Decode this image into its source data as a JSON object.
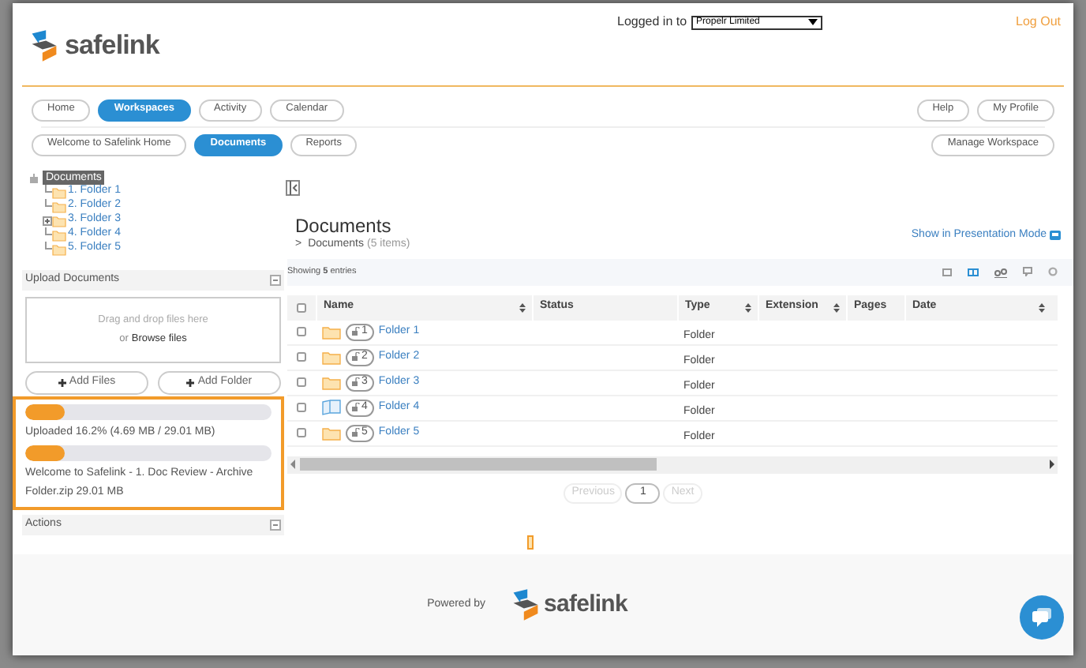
{
  "header": {
    "logo_text": "safelink",
    "logged_in_label": "Logged in to",
    "account": "Propelr Limited",
    "logout": "Log Out"
  },
  "nav": [
    {
      "label": "Home",
      "selected": false
    },
    {
      "label": "Workspaces",
      "selected": true
    },
    {
      "label": "Activity",
      "selected": false
    },
    {
      "label": "Calendar",
      "selected": false
    }
  ],
  "nav_right": [
    "Help",
    "My Profile"
  ],
  "subnav": [
    {
      "label": "Welcome to Safelink Home",
      "selected": false
    },
    {
      "label": "Documents",
      "selected": true
    },
    {
      "label": "Reports",
      "selected": false
    }
  ],
  "subnav_right": "Manage Workspace",
  "tree": {
    "label": "Documents",
    "selected": true,
    "children": [
      {
        "label": "1. Folder 1",
        "expandable": false
      },
      {
        "label": "2. Folder 2",
        "expandable": false
      },
      {
        "label": "3. Folder 3",
        "expandable": true
      },
      {
        "label": "4. Folder 4",
        "expandable": false
      },
      {
        "label": "5. Folder 5",
        "expandable": false
      }
    ]
  },
  "upload": {
    "title": "Upload Documents",
    "drop_text": "Drag and drop files here",
    "or": "or",
    "browse": "Browse files",
    "buttons": [
      "Add Files",
      "Add Folder"
    ],
    "progress": [
      {
        "level": 0.162,
        "text": "Uploaded 16.2% (4.69 MB / 29.01 MB)"
      },
      {
        "level": 0.162,
        "text": "Welcome to Safelink - 1. Doc Review - Archive Folder.zip 29.01 MB"
      }
    ]
  },
  "actions": {
    "title": "Actions"
  },
  "main": {
    "title": "Documents",
    "breadcrumb_sep": ">",
    "breadcrumb": "Documents",
    "count": "(5 items)",
    "presentation": "Show in Presentation Mode",
    "showing_pre": "Showing",
    "showing_num": "5",
    "showing_post": "entries"
  },
  "table": {
    "select_all_checked": false,
    "columns": [
      {
        "label": "Name",
        "sortable": true
      },
      {
        "label": "Status",
        "sortable": false
      },
      {
        "label": "Type",
        "sortable": true
      },
      {
        "label": "Extension",
        "sortable": true
      },
      {
        "label": "Pages",
        "sortable": false
      },
      {
        "label": "Date",
        "sortable": true
      }
    ],
    "rows": [
      {
        "kind": "folder",
        "number": "1",
        "name": "Folder 1",
        "type": "Folder",
        "checked": false
      },
      {
        "kind": "folder",
        "number": "2",
        "name": "Folder 2",
        "type": "Folder",
        "checked": false
      },
      {
        "kind": "folder",
        "number": "3",
        "name": "Folder 3",
        "type": "Folder",
        "checked": false
      },
      {
        "kind": "book",
        "number": "4",
        "name": "Folder 4",
        "type": "Folder",
        "checked": false
      },
      {
        "kind": "folder",
        "number": "5",
        "name": "Folder 5",
        "type": "Folder",
        "checked": false
      }
    ]
  },
  "pagination": {
    "previous": "Previous",
    "page": "1",
    "next": "Next"
  },
  "footer": {
    "powered_by": "Powered by",
    "logo_text": "safelink"
  }
}
